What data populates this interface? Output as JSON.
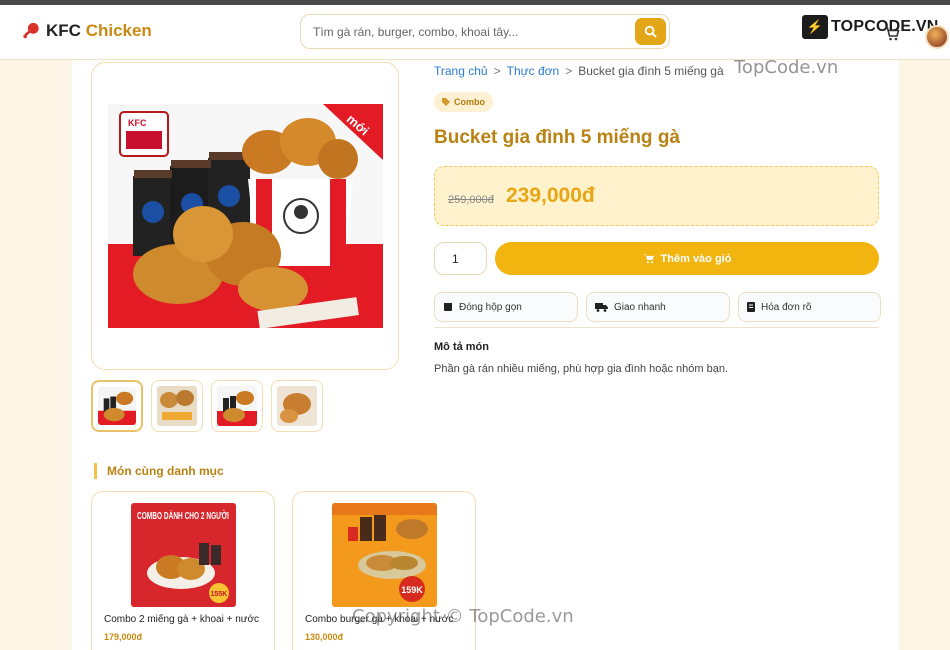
{
  "header": {
    "brand_name": "KFC",
    "brand_accent": "Chicken",
    "search_placeholder": "Tìm gà rán, burger, combo, khoai tây...",
    "watermark_logo": "TOPCODE.VN",
    "cart_icon": "cart-icon"
  },
  "breadcrumb": {
    "home": "Trang chủ",
    "separator": ">",
    "menu": "Thực đơn",
    "current": "Bucket gia đình 5 miếng gà"
  },
  "product": {
    "tag": "Combo",
    "title": "Bucket gia đình 5 miếng gà",
    "old_price": "259,000đ",
    "new_price": "239,000đ",
    "image_badge": "mới",
    "image_logo_text": "KFC",
    "quantity": "1",
    "add_to_cart": "Thêm vào giỏ",
    "features": [
      {
        "icon": "box-icon",
        "label": "Đóng hộp gọn"
      },
      {
        "icon": "truck-icon",
        "label": "Giao nhanh"
      },
      {
        "icon": "receipt-icon",
        "label": "Hóa đơn rõ"
      }
    ],
    "description_title": "Mô tả món",
    "description": "Phần gà rán nhiều miếng, phù hợp gia đình hoặc nhóm bạn."
  },
  "related": {
    "section_title": "Món cùng danh mục",
    "items": [
      {
        "name": "Combo 2 miếng gà + khoai + nước",
        "price": "179,000đ",
        "art_title": "COMBO DÀNH CHO 2 NGƯỜI",
        "art_badge": "155K"
      },
      {
        "name": "Combo burger gà + khoai + nước",
        "price": "130,000đ",
        "art_badge": "159K"
      }
    ]
  },
  "watermarks": {
    "top": "TopCode.vn",
    "bottom": "Copyright © TopCode.vn"
  },
  "colors": {
    "accent": "#e2a616",
    "title": "#b98314",
    "link": "#2a7bd0",
    "background": "#fdf6e6"
  }
}
